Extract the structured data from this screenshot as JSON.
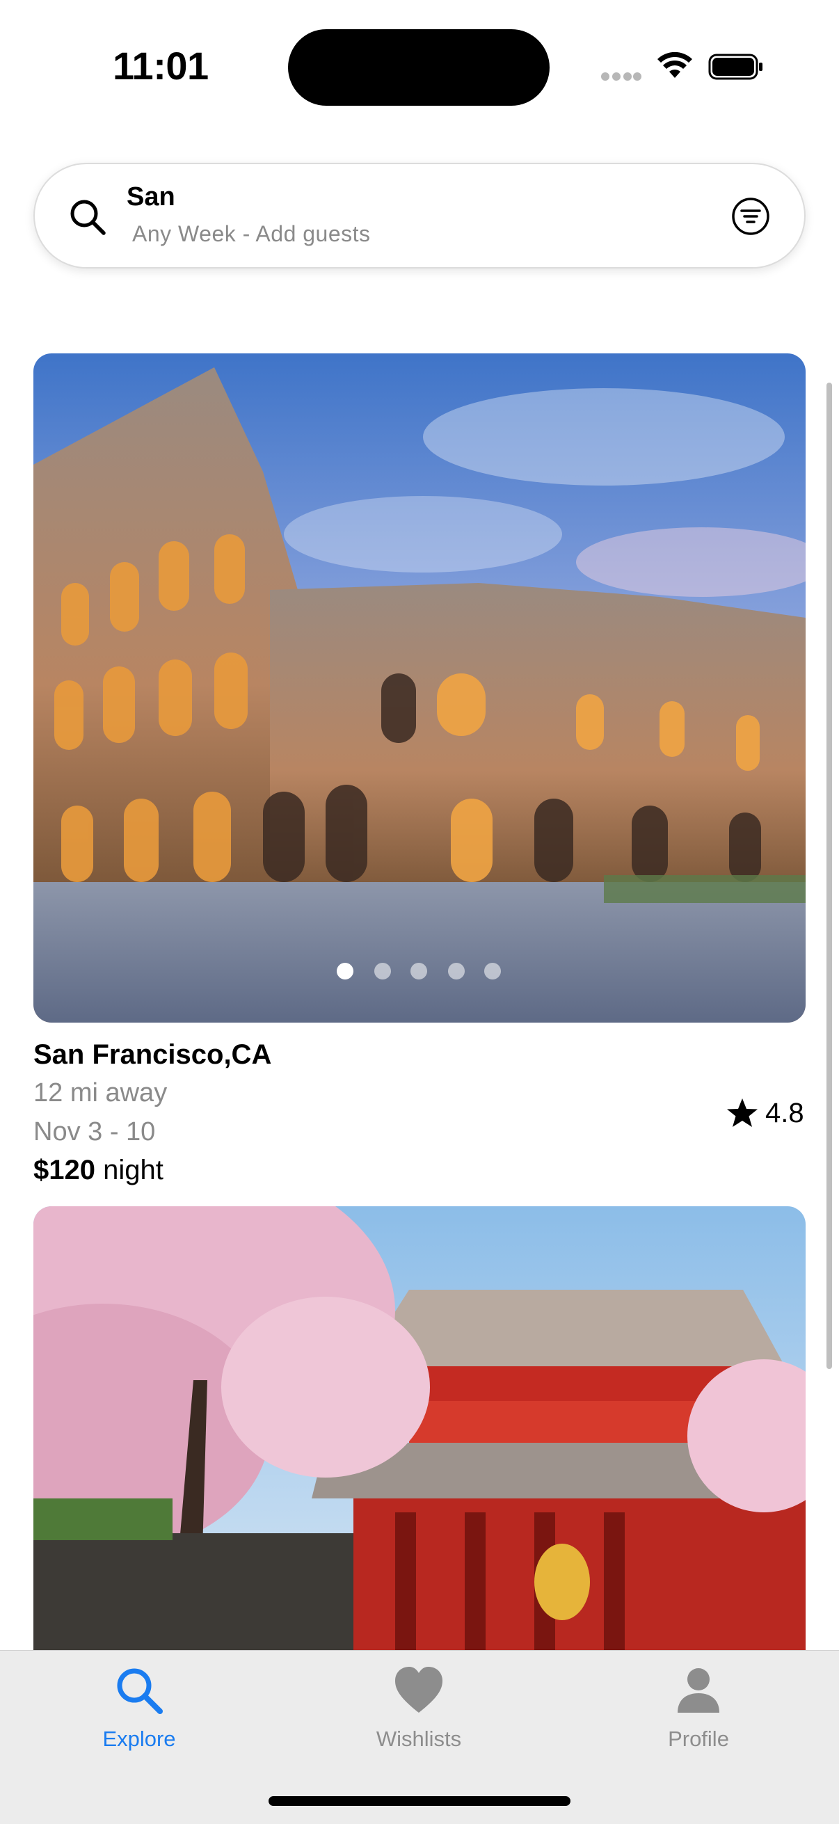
{
  "status_bar": {
    "time": "11:01",
    "icons": [
      "cellular-signal-icon",
      "wifi-icon",
      "battery-icon"
    ]
  },
  "search": {
    "query": "San",
    "subtitle": "Any Week - Add guests",
    "leading_icon": "search-icon",
    "trailing_icon": "filter-icon"
  },
  "listings": [
    {
      "title": "San Francisco,CA",
      "distance": "12 mi away",
      "dates": "Nov 3 - 10",
      "price": "$120",
      "price_unit": "night",
      "rating": "4.8",
      "photo_count": 5,
      "active_photo": 1
    }
  ],
  "tabs": [
    {
      "label": "Explore",
      "icon": "search-icon",
      "active": true
    },
    {
      "label": "Wishlists",
      "icon": "heart-icon",
      "active": false
    },
    {
      "label": "Profile",
      "icon": "person-icon",
      "active": false
    }
  ],
  "colors": {
    "accent": "#1a7cf0",
    "inactive_tab": "#8d8d8d",
    "secondary_text": "#8a8a8a"
  }
}
